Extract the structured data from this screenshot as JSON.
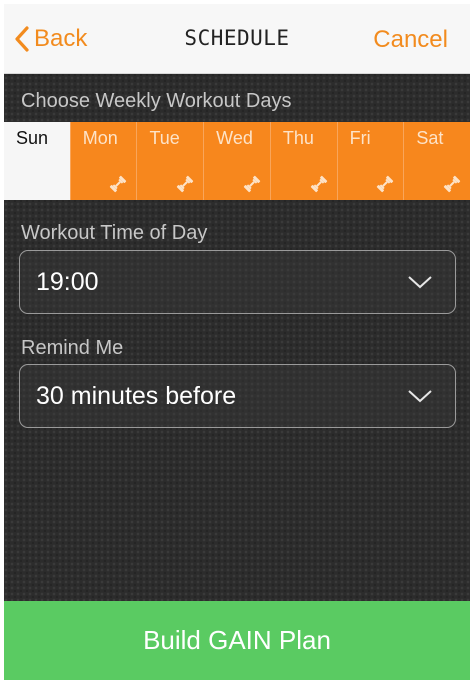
{
  "nav": {
    "back_label": "Back",
    "title": "SCHEDULE",
    "cancel_label": "Cancel"
  },
  "weekly_days": {
    "label": "Choose Weekly Workout Days",
    "days": [
      {
        "label": "Sun",
        "selected": false
      },
      {
        "label": "Mon",
        "selected": true
      },
      {
        "label": "Tue",
        "selected": true
      },
      {
        "label": "Wed",
        "selected": true
      },
      {
        "label": "Thu",
        "selected": true
      },
      {
        "label": "Fri",
        "selected": true
      },
      {
        "label": "Sat",
        "selected": true
      }
    ]
  },
  "workout_time": {
    "label": "Workout Time of Day",
    "value": "19:00"
  },
  "reminder": {
    "label": "Remind Me",
    "value": "30 minutes before"
  },
  "build_button": {
    "label": "Build GAIN Plan"
  },
  "colors": {
    "accent_orange": "#f7871d",
    "nav_orange": "#f28b1e",
    "button_green": "#5acb62"
  },
  "icons": {
    "back": "chevron-left-icon",
    "day_selected": "dumbbell-icon",
    "dropdown": "chevron-down-icon"
  }
}
